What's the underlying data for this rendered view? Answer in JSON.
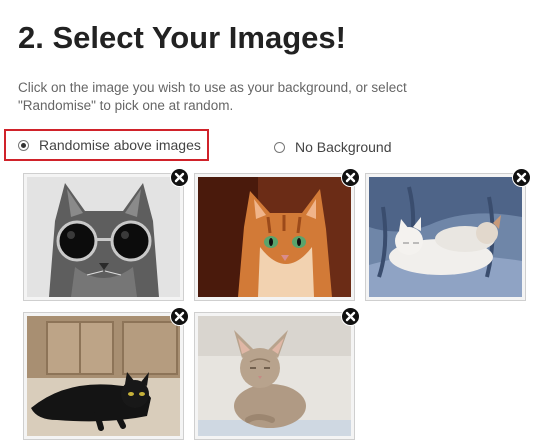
{
  "page": {
    "heading": "2. Select Your Images!",
    "instructions_line1": "Click on the image you wish to use as your background, or select",
    "instructions_line2": "\"Randomise\" to pick one at random."
  },
  "options": {
    "randomise_label": "Randomise above images",
    "randomise_checked": true,
    "no_background_label": "No Background",
    "no_background_checked": false,
    "highlight_color": "#d0222a"
  },
  "images": [
    {
      "subject": "grey cat wearing round sunglasses",
      "remove_icon": "close-icon"
    },
    {
      "subject": "orange tabby cat",
      "remove_icon": "close-icon"
    },
    {
      "subject": "two white cats sleeping on a bed",
      "remove_icon": "close-icon"
    },
    {
      "subject": "black cat lying on a floor",
      "remove_icon": "close-icon"
    },
    {
      "subject": "grey kitten sitting",
      "remove_icon": "close-icon"
    }
  ]
}
